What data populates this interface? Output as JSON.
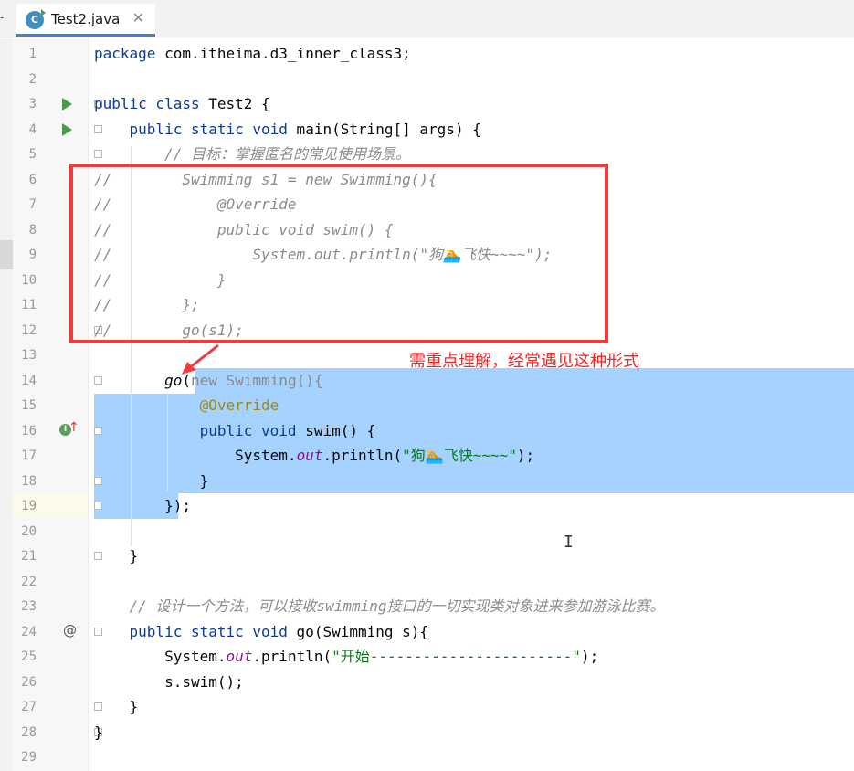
{
  "tab": {
    "filename": "Test2.java",
    "close": "✕",
    "icon_letter": "C",
    "icon": "java-class-icon"
  },
  "annotation": "需重点理解，经常遇见这种形式",
  "line_numbers": [
    "1",
    "2",
    "3",
    "4",
    "5",
    "6",
    "7",
    "8",
    "9",
    "10",
    "11",
    "12",
    "13",
    "14",
    "15",
    "16",
    "17",
    "18",
    "19",
    "20",
    "21",
    "22",
    "23",
    "24",
    "25",
    "26",
    "27",
    "28",
    "29"
  ],
  "code": {
    "l1": {
      "kw": "package",
      "rest": " com.itheima.d3_inner_class3;"
    },
    "l3": {
      "kw": "public class",
      "rest": " Test2 {"
    },
    "l4": {
      "kw": "public static void",
      "rest": " main(String[] args) {"
    },
    "l5": {
      "comment": "// 目标：掌握匿名的常见使用场景。"
    },
    "l6": {
      "comment": "//        Swimming s1 = new Swimming(){"
    },
    "l7": {
      "comment": "//            @Override"
    },
    "l8": {
      "comment": "//            public void swim() {"
    },
    "l9": {
      "comment": "//                System.out.println(\"狗🏊飞快~~~~\");"
    },
    "l10": {
      "comment": "//            }"
    },
    "l11": {
      "comment": "//        };"
    },
    "l12": {
      "comment": "//        go(s1);"
    },
    "l14": {
      "call": "go",
      "paren": "(",
      "kw": "new",
      "rest": " Swimming(){"
    },
    "l15": {
      "annotation": "@Override"
    },
    "l16": {
      "kw": "public void",
      "rest": " swim() {"
    },
    "l17": {
      "pre": "System.",
      "field": "out",
      "mid": ".println(",
      "str": "\"狗🏊飞快~~~~\"",
      "post": ");"
    },
    "l18": {
      "rest": "}"
    },
    "l19": {
      "rest": "});"
    },
    "l21": {
      "rest": "}"
    },
    "l23": {
      "comment": "// 设计一个方法，可以接收swimming接口的一切实现类对象进来参加游泳比赛。"
    },
    "l24": {
      "kw": "public static void",
      "rest": " go(Swimming s){"
    },
    "l25": {
      "pre": "System.",
      "field": "out",
      "mid": ".println(",
      "str": "\"开始-----------------------\"",
      "post": ");"
    },
    "l26": {
      "rest": "s.swim();"
    },
    "l27": {
      "rest": "}"
    },
    "l28": {
      "rest": "}"
    }
  },
  "gutter": {
    "run_icon": "run-icon",
    "implements_icon": "implements-icon",
    "impl_letter": "I",
    "up_arrow": "↑",
    "at_symbol": "@"
  },
  "cursor": "I",
  "colors": {
    "keyword": "#0b3b95",
    "comment": "#8c8c8c",
    "annotation": "#9e880d",
    "string": "#067d17",
    "selection": "#a6d2ff",
    "highlight_box": "#f03c3c"
  }
}
